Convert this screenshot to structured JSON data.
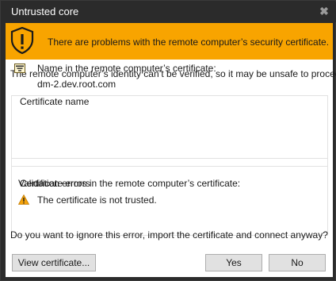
{
  "window": {
    "title": "Untrusted core",
    "close_glyph": "✖"
  },
  "banner": {
    "icon": "shield-warning-icon",
    "color": "#f8a400",
    "message": "There are problems with the remote computer’s security certificate."
  },
  "intro": "The remote computer’s identity can’t be verified, so it may be unsafe to proceed.",
  "certificate_name": {
    "legend": "Certificate name",
    "icon": "certificate-icon",
    "label": "Name in the remote computer’s certificate:",
    "value": "dm-2.dev.root.com"
  },
  "certificate_errors": {
    "legend": "Certificate errors",
    "label": "Validation errors in the remote computer’s certificate:",
    "icon": "warning-triangle-icon",
    "value": "The certificate is not trusted."
  },
  "question": "Do you want to ignore this error, import the certificate and connect anyway?",
  "buttons": {
    "view": "View certificate...",
    "yes": "Yes",
    "no": "No"
  }
}
